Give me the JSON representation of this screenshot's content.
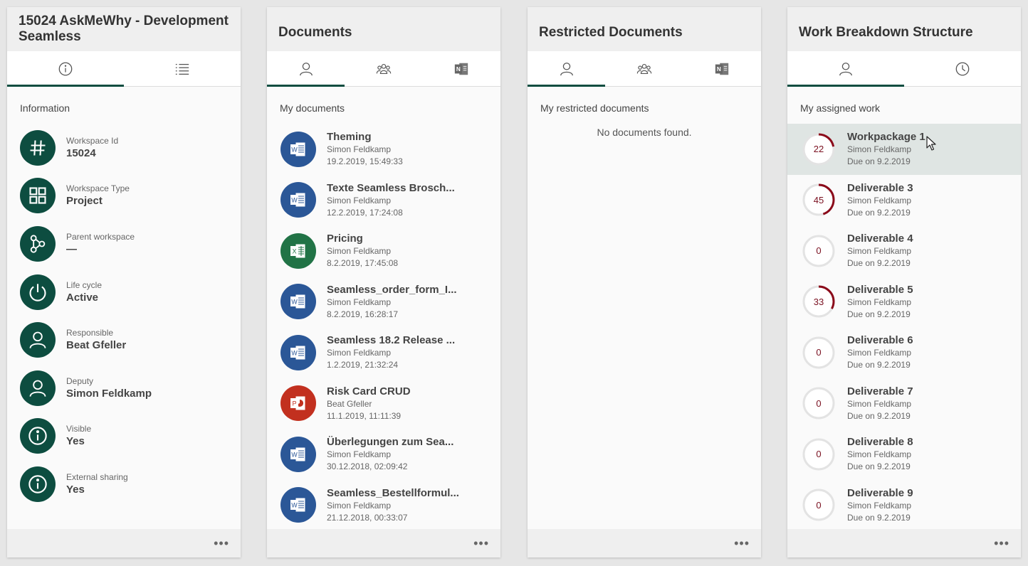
{
  "colors": {
    "accent": "#0d4d40",
    "word": "#2b5797",
    "excel": "#217346",
    "powerpoint": "#c2301f",
    "ring_progress": "#8b0a1a",
    "ring_track": "#e3e3e3"
  },
  "info_card": {
    "title": "15024 AskMeWhy - Development Seamless",
    "tabs": [
      "info-icon",
      "list-icon"
    ],
    "section_label": "Information",
    "items": [
      {
        "icon": "hash-icon",
        "label": "Workspace Id",
        "value": "15024"
      },
      {
        "icon": "grid-icon",
        "label": "Workspace Type",
        "value": "Project"
      },
      {
        "icon": "hierarchy-icon",
        "label": "Parent workspace",
        "value": "—"
      },
      {
        "icon": "power-icon",
        "label": "Life cycle",
        "value": "Active"
      },
      {
        "icon": "person-icon",
        "label": "Responsible",
        "value": "Beat Gfeller"
      },
      {
        "icon": "person-icon",
        "label": "Deputy",
        "value": "Simon Feldkamp"
      },
      {
        "icon": "info-icon",
        "label": "Visible",
        "value": "Yes"
      },
      {
        "icon": "info-icon",
        "label": "External sharing",
        "value": "Yes"
      }
    ],
    "more": "•••"
  },
  "documents_card": {
    "title": "Documents",
    "tabs": [
      "person-icon",
      "group-icon",
      "onenote-icon"
    ],
    "section_label": "My documents",
    "items": [
      {
        "type": "word",
        "title": "Theming",
        "author": "Simon Feldkamp",
        "date": "19.2.2019, 15:49:33"
      },
      {
        "type": "word",
        "title": "Texte Seamless Brosch...",
        "author": "Simon Feldkamp",
        "date": "12.2.2019, 17:24:08"
      },
      {
        "type": "excel",
        "title": "Pricing",
        "author": "Simon Feldkamp",
        "date": "8.2.2019, 17:45:08"
      },
      {
        "type": "word",
        "title": "Seamless_order_form_I...",
        "author": "Simon Feldkamp",
        "date": "8.2.2019, 16:28:17"
      },
      {
        "type": "word",
        "title": "Seamless 18.2 Release ...",
        "author": "Simon Feldkamp",
        "date": "1.2.2019, 21:32:24"
      },
      {
        "type": "powerpoint",
        "title": "Risk Card CRUD",
        "author": "Beat Gfeller",
        "date": "11.1.2019, 11:11:39"
      },
      {
        "type": "word",
        "title": "Überlegungen zum Sea...",
        "author": "Simon Feldkamp",
        "date": "30.12.2018, 02:09:42"
      },
      {
        "type": "word",
        "title": "Seamless_Bestellformul...",
        "author": "Simon Feldkamp",
        "date": "21.12.2018, 00:33:07"
      }
    ],
    "more": "•••"
  },
  "restricted_card": {
    "title": "Restricted Documents",
    "tabs": [
      "person-icon",
      "group-icon",
      "onenote-icon"
    ],
    "section_label": "My restricted documents",
    "empty": "No documents found.",
    "more": "•••"
  },
  "wbs_card": {
    "title": "Work Breakdown Structure",
    "tabs": [
      "person-icon",
      "clock-icon"
    ],
    "section_label": "My assigned work",
    "items": [
      {
        "title": "Workpackage 1",
        "assignee": "Simon Feldkamp",
        "due": "Due on 9.2.2019",
        "progress": 22
      },
      {
        "title": "Deliverable 3",
        "assignee": "Simon Feldkamp",
        "due": "Due on 9.2.2019",
        "progress": 45
      },
      {
        "title": "Deliverable 4",
        "assignee": "Simon Feldkamp",
        "due": "Due on 9.2.2019",
        "progress": 0
      },
      {
        "title": "Deliverable 5",
        "assignee": "Simon Feldkamp",
        "due": "Due on 9.2.2019",
        "progress": 33
      },
      {
        "title": "Deliverable 6",
        "assignee": "Simon Feldkamp",
        "due": "Due on 9.2.2019",
        "progress": 0
      },
      {
        "title": "Deliverable 7",
        "assignee": "Simon Feldkamp",
        "due": "Due on 9.2.2019",
        "progress": 0
      },
      {
        "title": "Deliverable 8",
        "assignee": "Simon Feldkamp",
        "due": "Due on 9.2.2019",
        "progress": 0
      },
      {
        "title": "Deliverable 9",
        "assignee": "Simon Feldkamp",
        "due": "Due on 9.2.2019",
        "progress": 0
      }
    ],
    "more": "•••"
  }
}
